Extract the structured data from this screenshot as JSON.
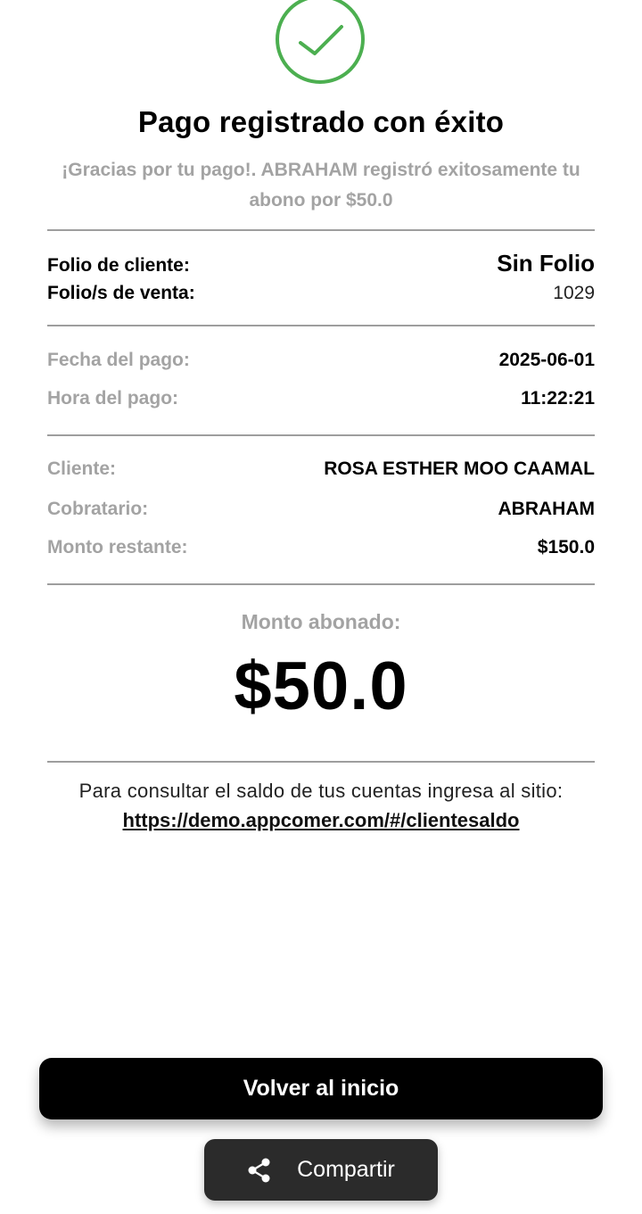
{
  "header": {
    "title": "Pago registrado con éxito",
    "subtitle": "¡Gracias por tu pago!. ABRAHAM registró exitosamente tu abono por $50.0"
  },
  "folio": {
    "cliente_label": "Folio de cliente:",
    "cliente_value": "Sin Folio",
    "venta_label": "Folio/s de venta:",
    "venta_value": "1029"
  },
  "payment": {
    "fecha_label": "Fecha del pago:",
    "fecha_value": "2025-06-01",
    "hora_label": "Hora del pago:",
    "hora_value": "11:22:21"
  },
  "details": {
    "cliente_label": "Cliente:",
    "cliente_value": "ROSA ESTHER MOO CAAMAL",
    "cobratario_label": "Cobratario:",
    "cobratario_value": "ABRAHAM",
    "restante_label": "Monto restante:",
    "restante_value": "$150.0"
  },
  "amount": {
    "label": "Monto abonado:",
    "value": "$50.0"
  },
  "info": {
    "text": "Para consultar el saldo de tus cuentas ingresa al sitio:",
    "link": "https://demo.appcomer.com/#/clientesaldo"
  },
  "actions": {
    "volver_label": "Volver al inicio",
    "share_label": "Compartir",
    "share_icon": "share-icon"
  },
  "colors": {
    "success": "#4caf50",
    "muted": "#a3a3a3",
    "primary_button": "#000000",
    "secondary_button": "#2b2b2b"
  }
}
